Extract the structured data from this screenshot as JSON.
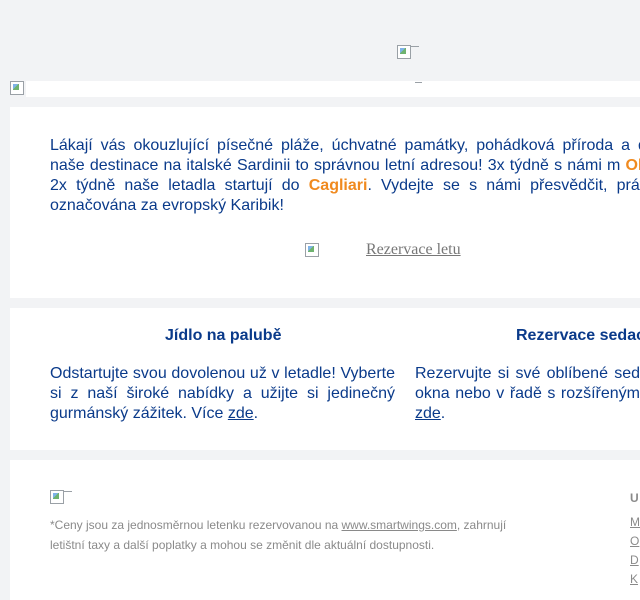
{
  "header": {
    "top_logo_icon": "broken-image-icon",
    "banner_icon": "broken-image-icon"
  },
  "intro": {
    "text_before": "Lákají vás okouzlující písečné pláže, úchvatné památky, pohádková příroda a dobr naše destinace na italské Sardinii to správnou letní adresou! 3x týdně s námi m ",
    "dest1": "Olbie",
    "text_middle": ", 2x týdně naše letadla startují do ",
    "dest2": "Cagliari",
    "text_after": ". Vydejte se s námi přesvědčit, právem označována za evropský Karibik!",
    "reserve_label": "Rezervace letu"
  },
  "columns": {
    "food": {
      "title": "Jídlo na palubě",
      "text": "Odstartujte svou dovolenou už v letadle! Vyberte si z naší široké nabídky a užijte si jedinečný gurmánský zážitek. Více ",
      "link": "zde",
      "suffix": "."
    },
    "seat": {
      "title": "Rezervace sedac",
      "text": "Rezervujte si své oblíbené sed okna nebo v řadě s rozšířeným ",
      "link": "zde",
      "suffix": "."
    }
  },
  "footer": {
    "disclaimer_before": "*Ceny jsou za jednosměrnou letenku rezervovanou na ",
    "disclaimer_link": "www.smartwings.com",
    "disclaimer_after": ", zahrnují letištní taxy a další poplatky a mohou se změnit dle aktuální dostupnosti.",
    "side_heading": "U",
    "side_links": [
      "M",
      "O",
      "D",
      "K"
    ]
  }
}
